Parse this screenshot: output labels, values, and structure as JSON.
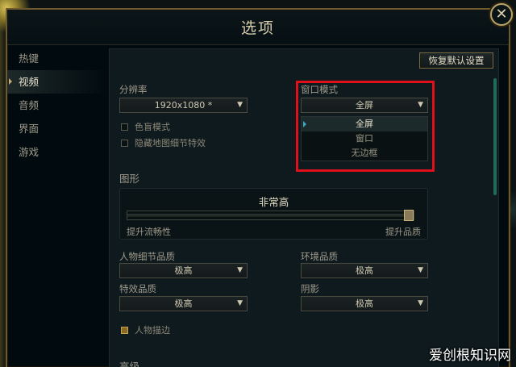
{
  "window": {
    "title": "选项",
    "close_glyph": "✕"
  },
  "sidebar": {
    "items": [
      {
        "label": "热键",
        "active": false
      },
      {
        "label": "视频",
        "active": true
      },
      {
        "label": "音频",
        "active": false
      },
      {
        "label": "界面",
        "active": false
      },
      {
        "label": "游戏",
        "active": false
      }
    ]
  },
  "panel": {
    "reset_label": "恢复默认设置",
    "resolution": {
      "label": "分辨率",
      "value": "1920x1080 *"
    },
    "colorblind": {
      "label": "色盲模式",
      "checked": false
    },
    "hide_details": {
      "label": "隐藏地图细节特效",
      "checked": false
    },
    "window_mode": {
      "label": "窗口模式",
      "value": "全屏",
      "options": [
        "全屏",
        "窗口",
        "无边框"
      ],
      "selected_index": 0
    },
    "graphics": {
      "section_title": "图形",
      "quality_value": "非常高",
      "slider_level": 1.0,
      "left_label": "提升流畅性",
      "right_label": "提升品质"
    },
    "character_quality": {
      "label": "人物细节品质",
      "value": "极高"
    },
    "environment_quality": {
      "label": "环境品质",
      "value": "极高"
    },
    "effects_quality": {
      "label": "特效品质",
      "value": "极高"
    },
    "shadows": {
      "label": "阴影",
      "value": "极高"
    },
    "character_outline": {
      "label": "人物描边",
      "checked": true
    },
    "advanced": {
      "section_title": "高级"
    }
  },
  "watermark": "爱创根知识网",
  "colors": {
    "highlight": "#e0101a",
    "accent_gold": "#c8aa6e",
    "scroll_teal": "#1f6a5c"
  },
  "icons": {
    "close": "close-icon",
    "dropdown": "chevron-down-icon",
    "selection_pointer": "caret-right-icon"
  }
}
